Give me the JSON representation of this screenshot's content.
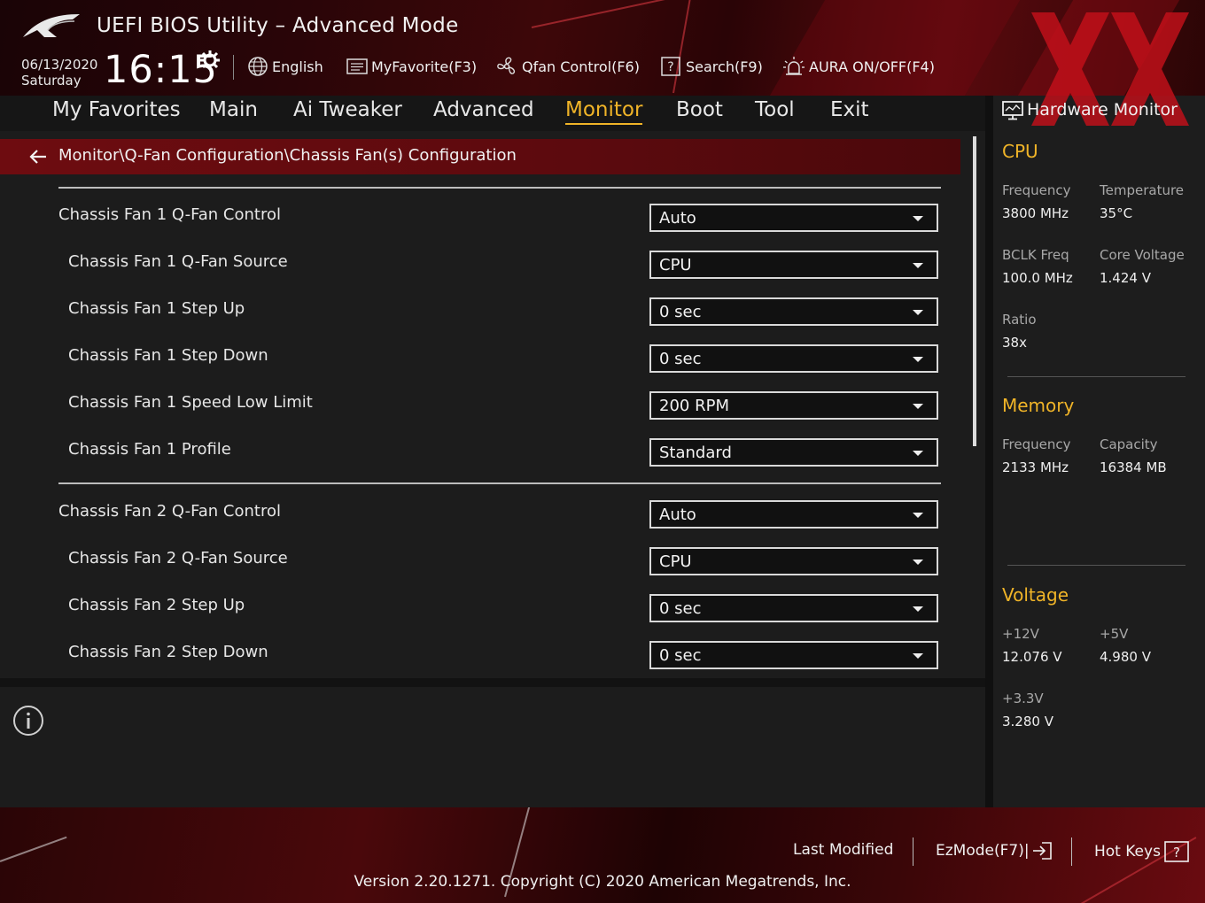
{
  "header": {
    "title": "UEFI BIOS Utility – Advanced Mode",
    "date": "06/13/2020",
    "day": "Saturday",
    "time": "16:15",
    "tools": {
      "language": "English",
      "my_favorite": "MyFavorite(F3)",
      "qfan": "Qfan Control(F6)",
      "search": "Search(F9)",
      "aura": "AURA ON/OFF(F4)"
    }
  },
  "nav": {
    "tabs": [
      "My Favorites",
      "Main",
      "Ai Tweaker",
      "Advanced",
      "Monitor",
      "Boot",
      "Tool",
      "Exit"
    ],
    "active": "Monitor"
  },
  "main": {
    "breadcrumb": "Monitor\\Q-Fan Configuration\\Chassis Fan(s) Configuration",
    "settings": [
      {
        "label": "Chassis Fan 1 Q-Fan Control",
        "value": "Auto"
      },
      {
        "label": "Chassis Fan 1 Q-Fan Source",
        "value": "CPU"
      },
      {
        "label": "Chassis Fan 1 Step Up",
        "value": "0 sec"
      },
      {
        "label": "Chassis Fan 1 Step Down",
        "value": "0 sec"
      },
      {
        "label": "Chassis Fan 1 Speed Low Limit",
        "value": "200 RPM"
      },
      {
        "label": "Chassis Fan 1 Profile",
        "value": "Standard"
      },
      {
        "label": "Chassis Fan 2 Q-Fan Control",
        "value": "Auto"
      },
      {
        "label": "Chassis Fan 2 Q-Fan Source",
        "value": "CPU"
      },
      {
        "label": "Chassis Fan 2 Step Up",
        "value": "0 sec"
      },
      {
        "label": "Chassis Fan 2 Step Down",
        "value": "0 sec"
      }
    ]
  },
  "hw_monitor": {
    "title": "Hardware Monitor",
    "cpu": {
      "heading": "CPU",
      "frequency_label": "Frequency",
      "frequency": "3800 MHz",
      "temperature_label": "Temperature",
      "temperature": "35°C",
      "bclk_label": "BCLK Freq",
      "bclk": "100.0 MHz",
      "core_voltage_label": "Core Voltage",
      "core_voltage": "1.424 V",
      "ratio_label": "Ratio",
      "ratio": "38x"
    },
    "memory": {
      "heading": "Memory",
      "frequency_label": "Frequency",
      "frequency": "2133 MHz",
      "capacity_label": "Capacity",
      "capacity": "16384 MB"
    },
    "voltage": {
      "heading": "Voltage",
      "v12_label": "+12V",
      "v12": "12.076 V",
      "v5_label": "+5V",
      "v5": "4.980 V",
      "v33_label": "+3.3V",
      "v33": "3.280 V"
    }
  },
  "footer": {
    "last_modified": "Last Modified",
    "ezmode": "EzMode(F7)|",
    "hot_keys": "Hot Keys",
    "version": "Version 2.20.1271. Copyright (C) 2020 American Megatrends, Inc."
  },
  "colors": {
    "accent": "#f0b428",
    "brand_red": "#6e0c10",
    "panel_bg": "#1c1c1c"
  }
}
